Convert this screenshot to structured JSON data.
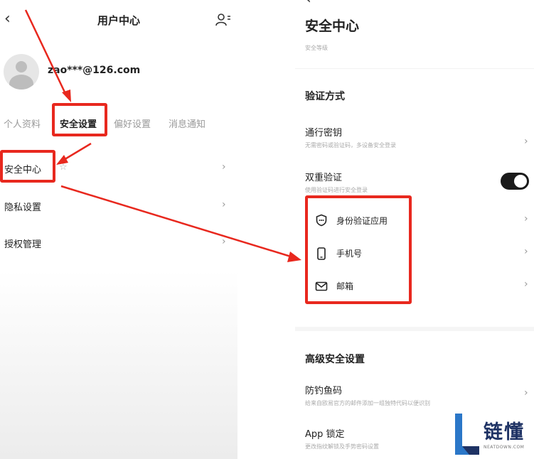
{
  "left": {
    "title": "用户中心",
    "email": "zao***@126.com",
    "tabs": [
      {
        "label": "个人资料"
      },
      {
        "label": "安全设置"
      },
      {
        "label": "偏好设置"
      },
      {
        "label": "消息通知"
      }
    ],
    "items": [
      {
        "label": "安全中心"
      },
      {
        "label": "隐私设置"
      },
      {
        "label": "授权管理"
      }
    ]
  },
  "right": {
    "title": "安全中心",
    "subtitle": "安全等级",
    "verify_section": "验证方式",
    "passkey": {
      "label": "通行密钥",
      "desc": "无需密码或验证码，多设备安全登录"
    },
    "two_factor": {
      "label": "双重验证",
      "desc": "使用验证码进行安全登录",
      "enabled": true
    },
    "methods": [
      {
        "label": "身份验证应用",
        "icon": "shield-icon"
      },
      {
        "label": "手机号",
        "icon": "phone-icon"
      },
      {
        "label": "邮箱",
        "icon": "mail-icon"
      }
    ],
    "advanced_section": "高级安全设置",
    "anti_phishing": {
      "label": "防钓鱼码",
      "desc": "给来自欧易官方的邮件添加一组独特代码以便识别"
    },
    "app_lock": {
      "label": "App 锁定",
      "desc": "更改指纹解锁及手势密码设置"
    }
  },
  "logo": {
    "text": "链懂",
    "sub": "NEATDOWN.COM"
  },
  "colors": {
    "annotation": "#e8281e",
    "toggle_on": "#1a1a1a",
    "logo_text": "#1e3264"
  }
}
